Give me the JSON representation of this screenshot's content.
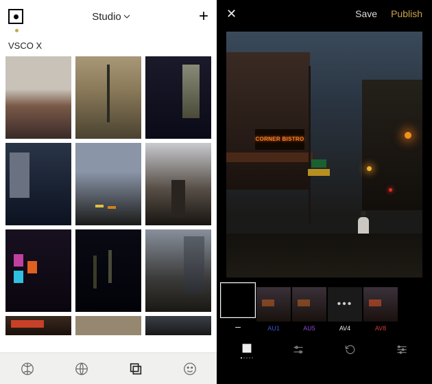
{
  "left": {
    "title": "Studio",
    "collection": "VSCO X"
  },
  "right": {
    "save": "Save",
    "publish": "Publish",
    "neon_sign": "CORNER BISTRO",
    "filters": {
      "none": "–",
      "au1": "AU1",
      "au5": "AU5",
      "more": "•••",
      "av4": "AV4",
      "av8": "AV8"
    }
  }
}
